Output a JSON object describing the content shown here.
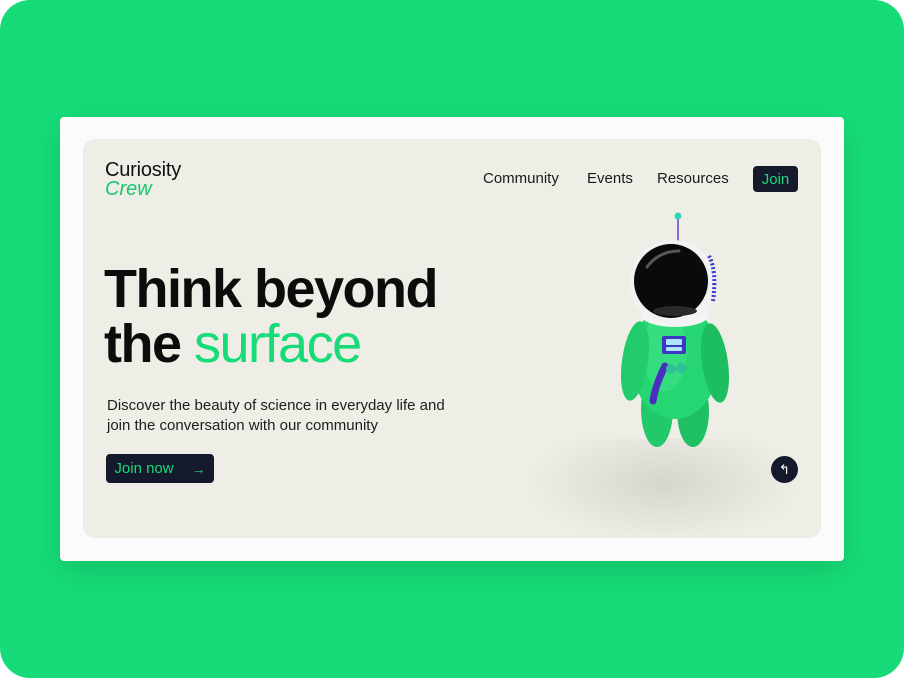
{
  "brand": {
    "line1": "Curiosity",
    "line2": "Crew"
  },
  "nav": {
    "items": [
      {
        "label": "Community"
      },
      {
        "label": "Events"
      },
      {
        "label": "Resources"
      }
    ],
    "join_label": "Join"
  },
  "hero": {
    "headline_line1": "Think beyond",
    "headline_line2_plain": "the",
    "headline_line2_accent": "surface",
    "description": "Discover the beauty of science in everyday life and join the conversation with our community",
    "cta_label": "Join now",
    "cta_icon": "arrow-right-icon",
    "floating_button_icon": "return-arrow-icon"
  },
  "colors": {
    "accent": "#16db78",
    "dark": "#141a2b",
    "page_bg": "#eeeee6",
    "outer_bg": "#16db78"
  }
}
